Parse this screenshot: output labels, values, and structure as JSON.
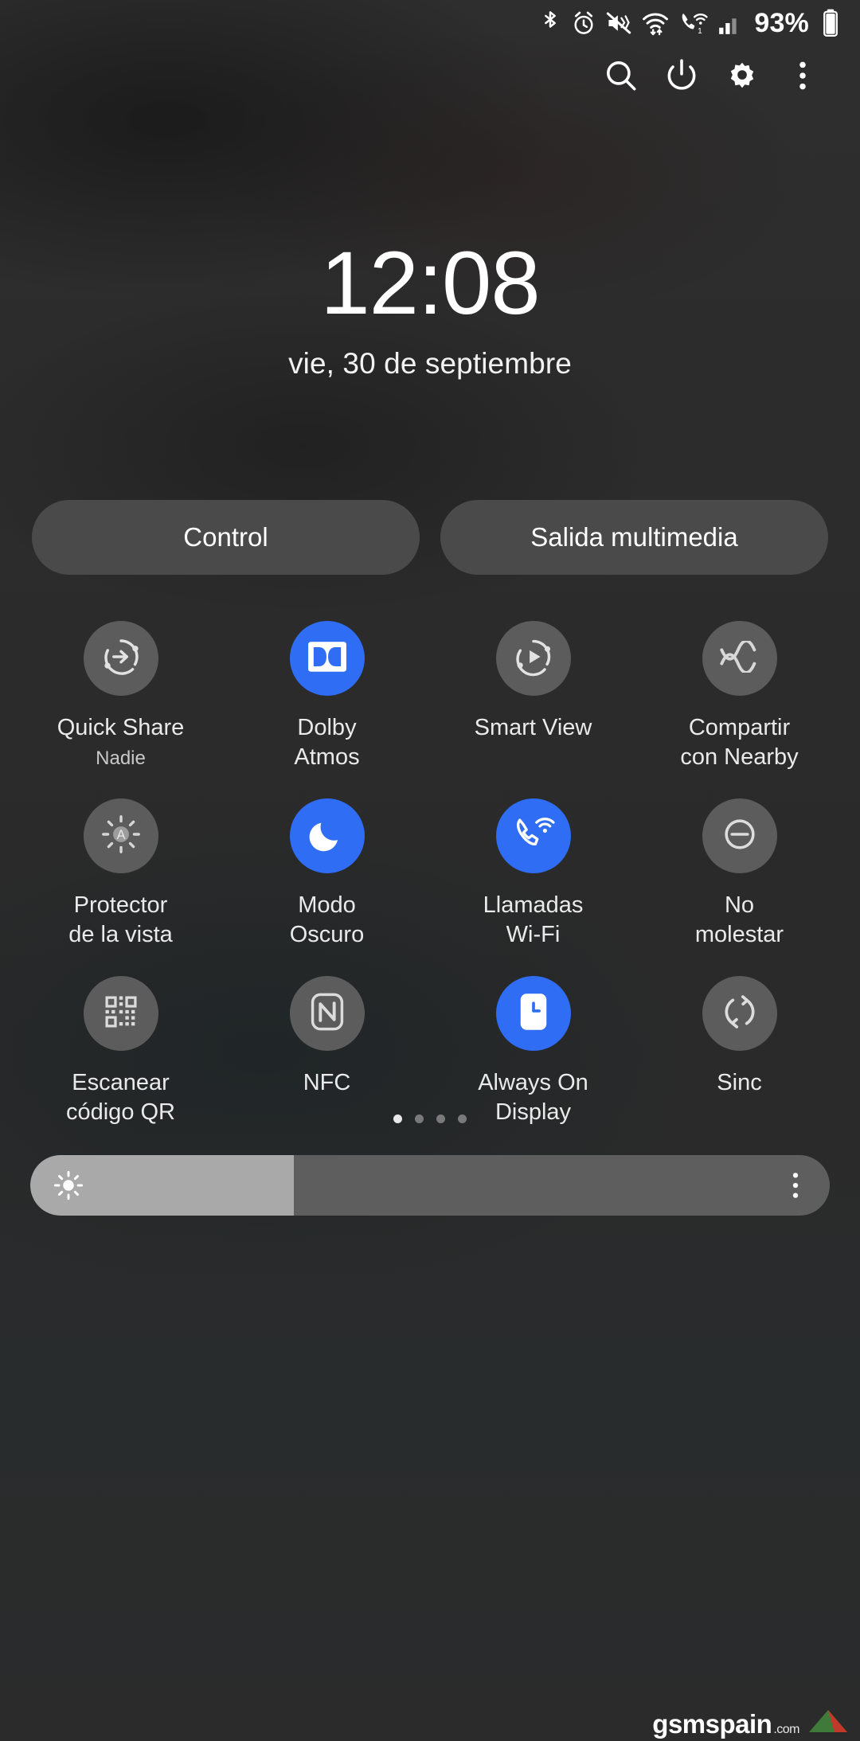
{
  "statusbar": {
    "icons": [
      "bluetooth-icon",
      "alarm-icon",
      "mute-vibrate-icon",
      "wifi-icon",
      "wifi-calling-icon",
      "signal-bars-icon"
    ],
    "battery_percent": "93%",
    "sim_indicator": "1"
  },
  "header": {
    "actions": [
      {
        "name": "search-icon",
        "label": "Buscar"
      },
      {
        "name": "power-icon",
        "label": "Apagar"
      },
      {
        "name": "gear-icon",
        "label": "Ajustes"
      },
      {
        "name": "overflow-menu-icon",
        "label": "Más opciones"
      }
    ]
  },
  "clock": {
    "time": "12:08",
    "date": "vie, 30 de septiembre"
  },
  "pills": [
    {
      "label": "Control",
      "name": "control-button"
    },
    {
      "label": "Salida multimedia",
      "name": "media-output-button"
    }
  ],
  "tiles": [
    {
      "label": "Quick Share",
      "sublabel": "Nadie",
      "icon": "quick-share-icon",
      "active": false
    },
    {
      "label": "Dolby\nAtmos",
      "sublabel": "",
      "icon": "dolby-atmos-icon",
      "active": true
    },
    {
      "label": "Smart View",
      "sublabel": "",
      "icon": "smart-view-icon",
      "active": false
    },
    {
      "label": "Compartir\ncon Nearby",
      "sublabel": "",
      "icon": "nearby-share-icon",
      "active": false
    },
    {
      "label": "Protector\nde la vista",
      "sublabel": "",
      "icon": "eye-comfort-shield-icon",
      "active": false
    },
    {
      "label": "Modo\nOscuro",
      "sublabel": "",
      "icon": "dark-mode-moon-icon",
      "active": true
    },
    {
      "label": "Llamadas\nWi-Fi",
      "sublabel": "",
      "icon": "wifi-calling-icon",
      "active": true
    },
    {
      "label": "No\nmolestar",
      "sublabel": "",
      "icon": "do-not-disturb-icon",
      "active": false
    },
    {
      "label": "Escanear\ncódigo QR",
      "sublabel": "",
      "icon": "qr-scan-icon",
      "active": false
    },
    {
      "label": "NFC",
      "sublabel": "",
      "icon": "nfc-icon",
      "active": false
    },
    {
      "label": "Always On\nDisplay",
      "sublabel": "",
      "icon": "always-on-display-icon",
      "active": true
    },
    {
      "label": "Sinc",
      "sublabel": "",
      "icon": "sync-icon",
      "active": false
    }
  ],
  "pagination": {
    "total": 4,
    "active_index": 0
  },
  "brightness": {
    "value_percent": 33,
    "sun_icon": "brightness-sun-icon",
    "more_icon": "brightness-options-icon"
  },
  "watermark": {
    "text": "gsmspain",
    "suffix": ".com"
  },
  "colors": {
    "accent_on": "#2f6df4",
    "tile_off": "#5c5c5c",
    "pill_bg": "#4a4a4a",
    "panel_bg": "#2b2b2b"
  }
}
